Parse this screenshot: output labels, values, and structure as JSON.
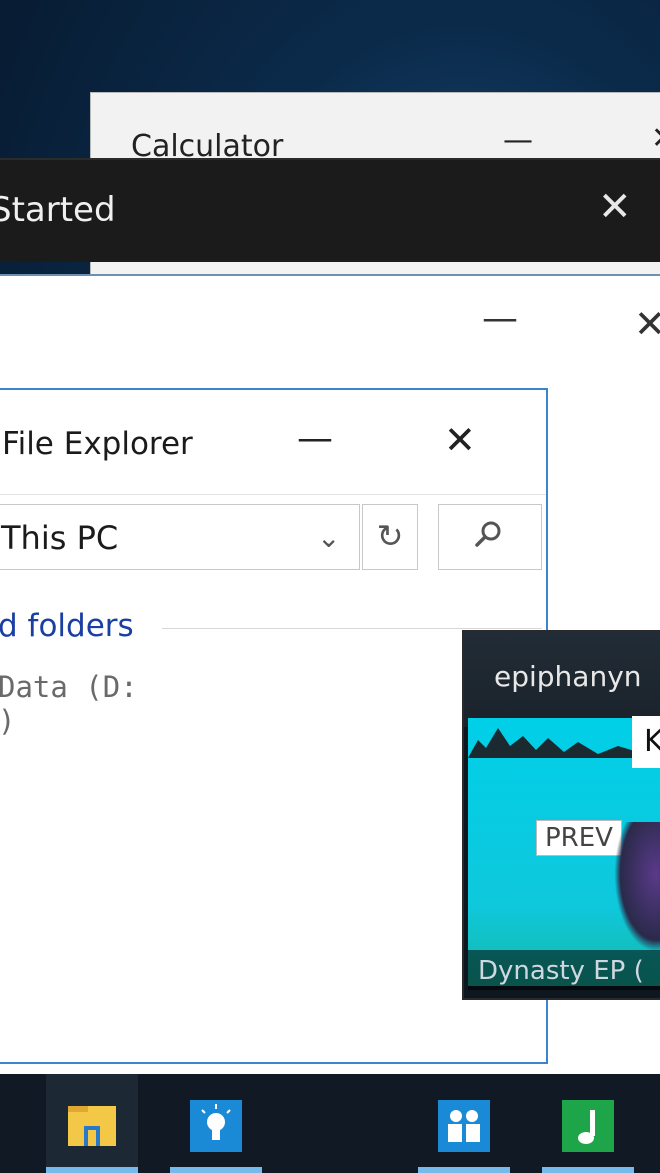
{
  "calculator": {
    "title": "Calculator",
    "minimize": "—",
    "close": "✕"
  },
  "get_started": {
    "title": "Started",
    "close": "✕"
  },
  "background_window": {
    "minimize": "—",
    "close": "✕"
  },
  "file_explorer": {
    "title": "File Explorer",
    "minimize": "—",
    "close": "✕",
    "address": "This PC",
    "section_header": "d folders",
    "drive_label_line1": "Data (D:",
    "drive_label_line2": ")"
  },
  "media_thumb": {
    "artist": "epiphanyn",
    "k_label": "K",
    "prev_label": "PREV",
    "caption": "Dynasty EP (",
    "colors": {
      "art_top": "#00cfe8",
      "art_bottom": "#14b8a8"
    }
  },
  "taskbar": {
    "items": [
      {
        "name": "file-explorer",
        "icon": "folder-icon",
        "active": true
      },
      {
        "name": "tips",
        "icon": "lightbulb-icon",
        "active": false
      },
      {
        "name": "people",
        "icon": "people-icon",
        "active": false
      },
      {
        "name": "music",
        "icon": "music-note-icon",
        "active": false
      }
    ],
    "indicator_color": "#76b9ed"
  }
}
